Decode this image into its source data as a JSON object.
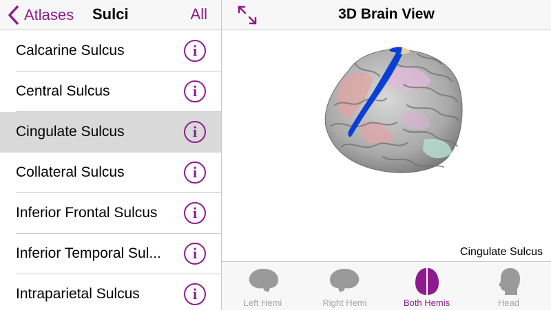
{
  "left_nav": {
    "back_label": "Atlases",
    "title": "Sulci",
    "all_label": "All"
  },
  "sulci": [
    {
      "label": "Calcarine Sulcus",
      "info_icon": "i"
    },
    {
      "label": "Central Sulcus",
      "info_icon": "i"
    },
    {
      "label": "Cingulate Sulcus",
      "info_icon": "i"
    },
    {
      "label": "Collateral Sulcus",
      "info_icon": "i"
    },
    {
      "label": "Inferior Frontal Sulcus",
      "info_icon": "i"
    },
    {
      "label": "Inferior Temporal Sul...",
      "info_icon": "i"
    },
    {
      "label": "Intraparietal Sulcus",
      "info_icon": "i"
    }
  ],
  "selected_index": 2,
  "right_nav": {
    "title": "3D Brain View"
  },
  "viewer": {
    "caption": "Cingulate Sulcus"
  },
  "tabs": [
    {
      "label": "Left Hemi",
      "icon": "left-hemisphere-icon"
    },
    {
      "label": "Right Hemi",
      "icon": "right-hemisphere-icon"
    },
    {
      "label": "Both Hemis",
      "icon": "both-hemispheres-icon"
    },
    {
      "label": "Head",
      "icon": "head-icon"
    }
  ],
  "active_tab_index": 2,
  "colors": {
    "accent": "#8e1b8e",
    "inactive_tab": "#a6a6a6",
    "selected_row": "#d9d9d9",
    "highlight_sulcus": "#0a3fd6"
  }
}
